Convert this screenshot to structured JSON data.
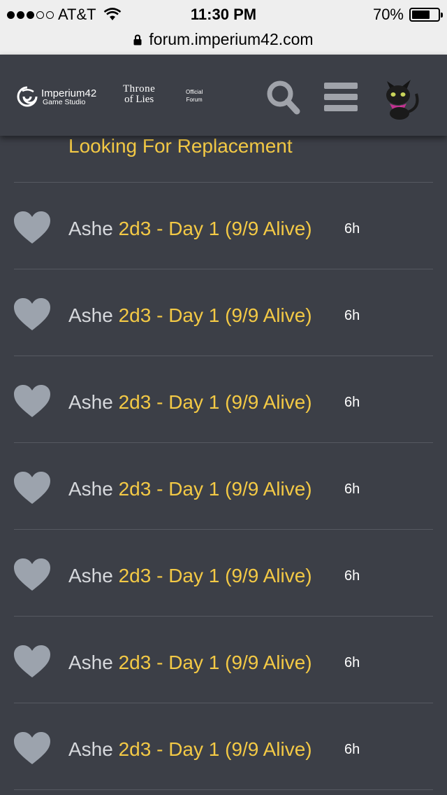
{
  "status_bar": {
    "carrier": "AT&T",
    "time": "11:30 PM",
    "battery_percent": "70%",
    "battery_level": 0.7,
    "signal_bars": 3
  },
  "url_bar": {
    "url": "forum.imperium42.com"
  },
  "header": {
    "brand_name": "Imperium42",
    "brand_sub": "Game Studio",
    "game_title_line1": "Throne",
    "game_title_line2": "of Lies",
    "official_line1": "Official",
    "official_line2": "Forum"
  },
  "partial_topic": {
    "title": "Looking For Replacement"
  },
  "topics": [
    {
      "poster": "Ashe",
      "title": "2d3 - Day 1 (9/9 Alive)",
      "age": "6h"
    },
    {
      "poster": "Ashe",
      "title": "2d3 - Day 1 (9/9 Alive)",
      "age": "6h"
    },
    {
      "poster": "Ashe",
      "title": "2d3 - Day 1 (9/9 Alive)",
      "age": "6h"
    },
    {
      "poster": "Ashe",
      "title": "2d3 - Day 1 (9/9 Alive)",
      "age": "6h"
    },
    {
      "poster": "Ashe",
      "title": "2d3 - Day 1 (9/9 Alive)",
      "age": "6h"
    },
    {
      "poster": "Ashe",
      "title": "2d3 - Day 1 (9/9 Alive)",
      "age": "6h"
    },
    {
      "poster": "Ashe",
      "title": "2d3 - Day 1 (9/9 Alive)",
      "age": "6h"
    }
  ],
  "icons": {
    "search": "search-icon",
    "menu": "hamburger-menu-icon",
    "avatar": "black-cat-avatar",
    "heart": "heart-icon",
    "lock": "lock-icon"
  },
  "colors": {
    "background": "#3c3f47",
    "title_accent": "#f3c945",
    "poster_text": "#d6d8dc",
    "icon_gray": "#a0a3aa",
    "heart_gray": "#9ca3ad"
  }
}
